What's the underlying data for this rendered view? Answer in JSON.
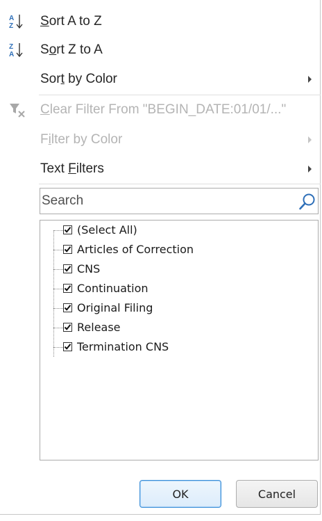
{
  "menu": {
    "sort_az": {
      "label_pre": "",
      "label_ul": "S",
      "label_post": "ort A to Z",
      "icon": "sort-ascending-icon"
    },
    "sort_za": {
      "label_pre": "S",
      "label_ul": "o",
      "label_post": "rt Z to A",
      "icon": "sort-descending-icon"
    },
    "sort_by_color": {
      "label_pre": "Sor",
      "label_ul": "t",
      "label_post": " by Color"
    },
    "clear_filter": {
      "label_pre": "",
      "label_ul": "C",
      "label_post": "lear Filter From \"BEGIN_DATE:01/01/...\"",
      "icon": "clear-filter-icon"
    },
    "filter_by_color": {
      "label_pre": "F",
      "label_ul": "i",
      "label_post": "lter by Color"
    },
    "text_filters": {
      "label_pre": "Text ",
      "label_ul": "F",
      "label_post": "ilters"
    }
  },
  "search": {
    "placeholder": "Search",
    "value": ""
  },
  "filter_list": [
    {
      "label": "(Select All)",
      "checked": true
    },
    {
      "label": "Articles of Correction",
      "checked": true
    },
    {
      "label": "CNS",
      "checked": true
    },
    {
      "label": "Continuation",
      "checked": true
    },
    {
      "label": "Original Filing",
      "checked": true
    },
    {
      "label": "Release",
      "checked": true
    },
    {
      "label": "Termination CNS",
      "checked": true
    }
  ],
  "buttons": {
    "ok": "OK",
    "cancel": "Cancel"
  },
  "colors": {
    "accent_blue": "#3c8fd8",
    "sort_icon_blue": "#2e6fb8",
    "disabled_text": "#b4b4b4"
  }
}
